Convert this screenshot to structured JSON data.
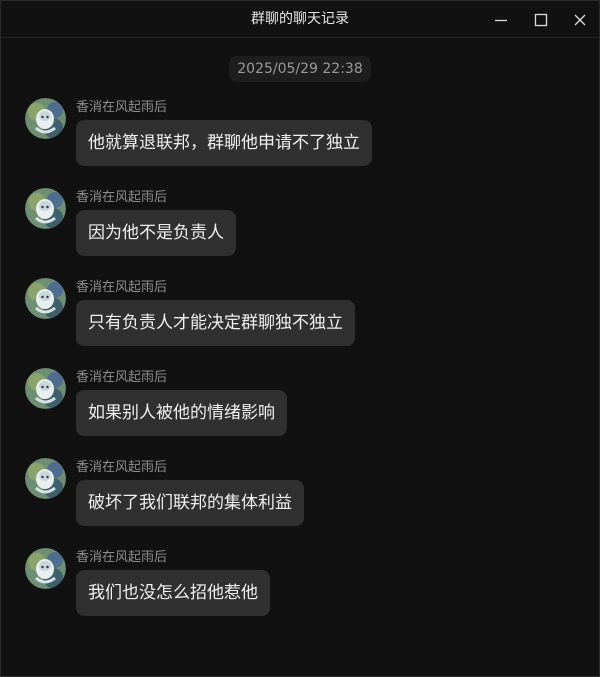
{
  "window": {
    "title": "群聊的聊天记录"
  },
  "timestamp": "2025/05/29 22:38",
  "messages": [
    {
      "sender": "香消在风起雨后",
      "text": "他就算退联邦，群聊他申请不了独立"
    },
    {
      "sender": "香消在风起雨后",
      "text": "因为他不是负责人"
    },
    {
      "sender": "香消在风起雨后",
      "text": "只有负责人才能决定群聊独不独立"
    },
    {
      "sender": "香消在风起雨后",
      "text": "如果别人被他的情绪影响"
    },
    {
      "sender": "香消在风起雨后",
      "text": "破坏了我们联邦的集体利益"
    },
    {
      "sender": "香消在风起雨后",
      "text": "我们也没怎么招他惹他"
    }
  ],
  "icons": {
    "minimize": "minimize-icon",
    "maximize": "maximize-icon",
    "close": "close-icon",
    "avatar": "avatar"
  },
  "colors": {
    "background": "#111111",
    "bubble": "#303030",
    "sender_text": "#8e8e8e",
    "message_text": "#f0f0f0"
  }
}
